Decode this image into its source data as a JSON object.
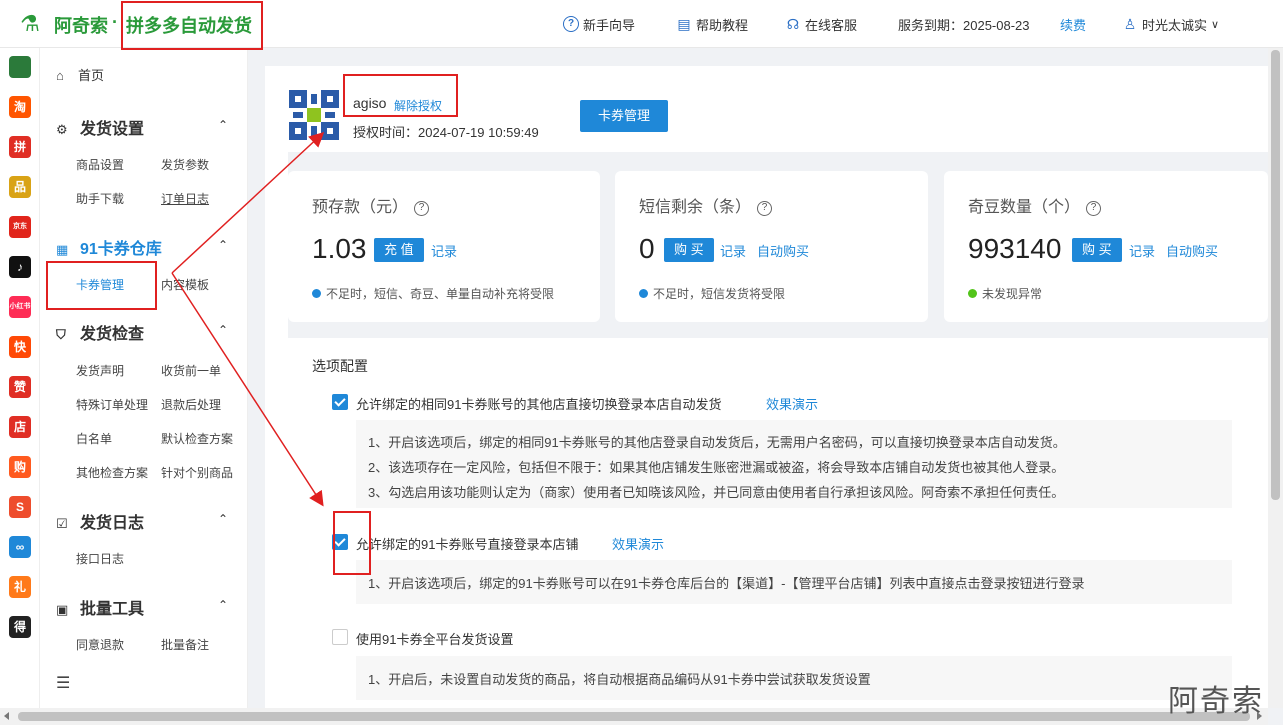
{
  "header": {
    "brand": "阿奇索",
    "brand_dot": "·",
    "brand_sub": "拼多多自动发货",
    "nav": {
      "guide": "新手向导",
      "help": "帮助教程",
      "service": "在线客服",
      "expire_label": "服务到期：2025-08-23",
      "renew": "续费",
      "user": "时光太诚实"
    }
  },
  "rail": {
    "items": [
      {
        "icon": "qr-icon",
        "label": "",
        "color": "#2b7a3a"
      },
      {
        "icon": "taobao-icon",
        "label": "淘",
        "color": "#ff5500"
      },
      {
        "icon": "pinduoduo-icon",
        "label": "拼",
        "color": "#e02e24"
      },
      {
        "icon": "1688-icon",
        "label": "品",
        "color": "#d9a316"
      },
      {
        "icon": "jd-icon",
        "label": "京东",
        "color": "#e1251b"
      },
      {
        "icon": "douyin-icon",
        "label": "♪",
        "color": "#111111"
      },
      {
        "icon": "xiaohongshu-icon",
        "label": "小红书",
        "color": "#fe2c55"
      },
      {
        "icon": "kuaishou-icon",
        "label": "快",
        "color": "#ff4906"
      },
      {
        "icon": "thumbs-icon",
        "label": "赞",
        "color": "#e02e24"
      },
      {
        "icon": "shop-icon",
        "label": "店",
        "color": "#e02e24"
      },
      {
        "icon": "bag-icon",
        "label": "购",
        "color": "#ff5a1f"
      },
      {
        "icon": "shopee-icon",
        "label": "S",
        "color": "#ee4d2d"
      },
      {
        "icon": "link-icon",
        "label": "∞",
        "color": "#1f88d8"
      },
      {
        "icon": "gift-icon",
        "label": "礼",
        "color": "#ff7a1a"
      },
      {
        "icon": "dewu-icon",
        "label": "得",
        "color": "#222222"
      }
    ]
  },
  "sidebar": {
    "home": "首页",
    "groups": [
      {
        "label": "发货设置",
        "subs": [
          "商品设置",
          "发货参数",
          "助手下载",
          "订单日志"
        ]
      },
      {
        "label": "91卡券仓库",
        "subs": [
          "卡券管理",
          "内容模板"
        ]
      },
      {
        "label": "发货检查",
        "subs": [
          "发货声明",
          "收货前一单",
          "特殊订单处理",
          "退款后处理",
          "白名单",
          "默认检查方案",
          "其他检查方案",
          "针对个别商品"
        ]
      },
      {
        "label": "发货日志",
        "subs": [
          "接口日志"
        ]
      },
      {
        "label": "批量工具",
        "subs": [
          "同意退款",
          "批量备注"
        ]
      }
    ]
  },
  "account": {
    "name": "agiso",
    "unbind": "解除授权",
    "time": "授权时间：2024-07-19 10:59:49",
    "button": "卡券管理"
  },
  "stats": [
    {
      "title": "预存款（元）",
      "value": "1.03",
      "button": "充 值",
      "links": [
        "记录"
      ],
      "note": "不足时，短信、奇豆、单量自动补充将受限"
    },
    {
      "title": "短信剩余（条）",
      "value": "0",
      "button": "购 买",
      "links": [
        "记录",
        "自动购买"
      ],
      "note": "不足时，短信发货将受限"
    },
    {
      "title": "奇豆数量（个）",
      "value": "993140",
      "button": "购 买",
      "links": [
        "记录",
        "自动购买"
      ],
      "note": "未发现异常"
    }
  ],
  "options": {
    "title": "选项配置",
    "items": [
      {
        "checked": true,
        "label": "允许绑定的相同91卡券账号的其他店直接切换登录本店自动发货",
        "link": "效果演示",
        "lines": [
          "1、开启该选项后，绑定的相同91卡券账号的其他店登录自动发货后，无需用户名密码，可以直接切换登录本店自动发货。",
          "2、该选项存在一定风险，包括但不限于：如果其他店铺发生账密泄漏或被盗，将会导致本店铺自动发货也被其他人登录。",
          "3、勾选启用该功能则认定为（商家）使用者已知晓该风险，并已同意由使用者自行承担该风险。阿奇索不承担任何责任。"
        ]
      },
      {
        "checked": true,
        "label": "允许绑定的91卡券账号直接登录本店铺",
        "link": "效果演示",
        "lines": [
          "1、开启该选项后，绑定的91卡券账号可以在91卡券仓库后台的【渠道】-【管理平台店铺】列表中直接点击登录按钮进行登录"
        ]
      },
      {
        "checked": false,
        "label": "使用91卡券全平台发货设置",
        "link": "",
        "lines": [
          "1、开启后，未设置自动发货的商品，将自动根据商品编码从91卡券中尝试获取发货设置"
        ]
      }
    ]
  },
  "watermark": "阿奇索",
  "colors": {
    "brand": "#2a9a3a",
    "accent": "#1f88d8",
    "highlight": "#e02020"
  }
}
